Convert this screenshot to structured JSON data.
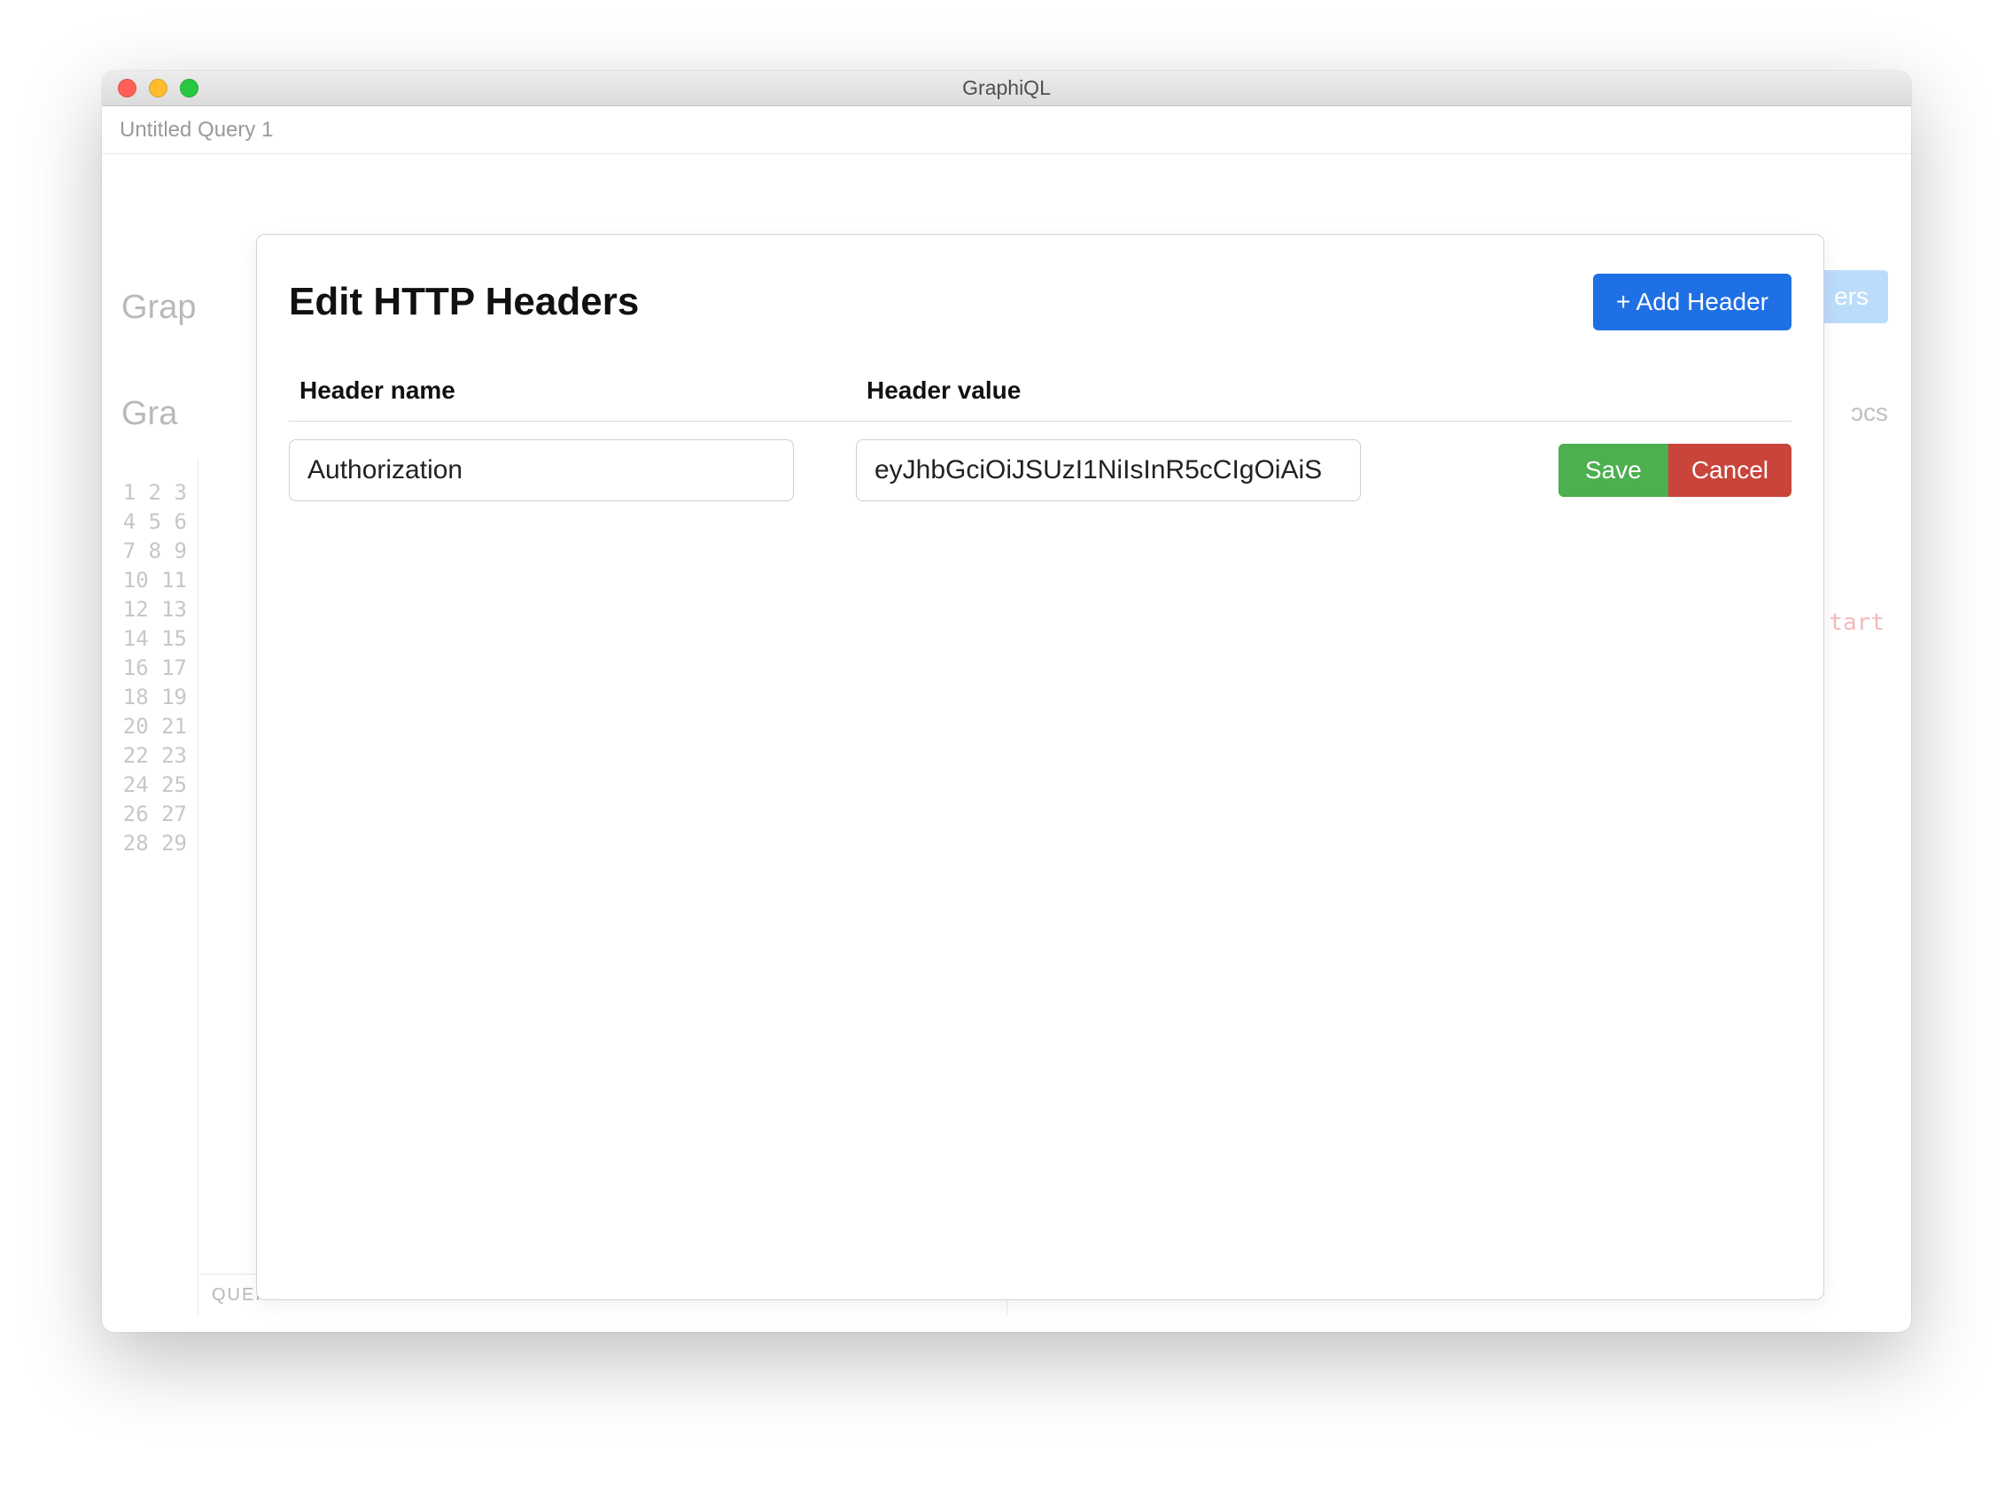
{
  "window": {
    "title": "GraphiQL"
  },
  "tabs": {
    "active": "Untitled Query 1"
  },
  "bg": {
    "word1": "Grap",
    "word2": "Gra",
    "right_btn_fragment": "ers",
    "docs_fragment": "ɔcs",
    "monospace_fragment": "tart"
  },
  "editor": {
    "line_start": 1,
    "line_end": 29,
    "query_variables_label": "QUERY VARIABLES"
  },
  "modal": {
    "title": "Edit HTTP Headers",
    "add_button": "+ Add Header",
    "columns": {
      "name": "Header name",
      "value": "Header value"
    },
    "rows": [
      {
        "name": "Authorization",
        "value": "eyJhbGciOiJSUzI1NiIsInR5cCIgOiAiS"
      }
    ],
    "save_label": "Save",
    "cancel_label": "Cancel"
  }
}
